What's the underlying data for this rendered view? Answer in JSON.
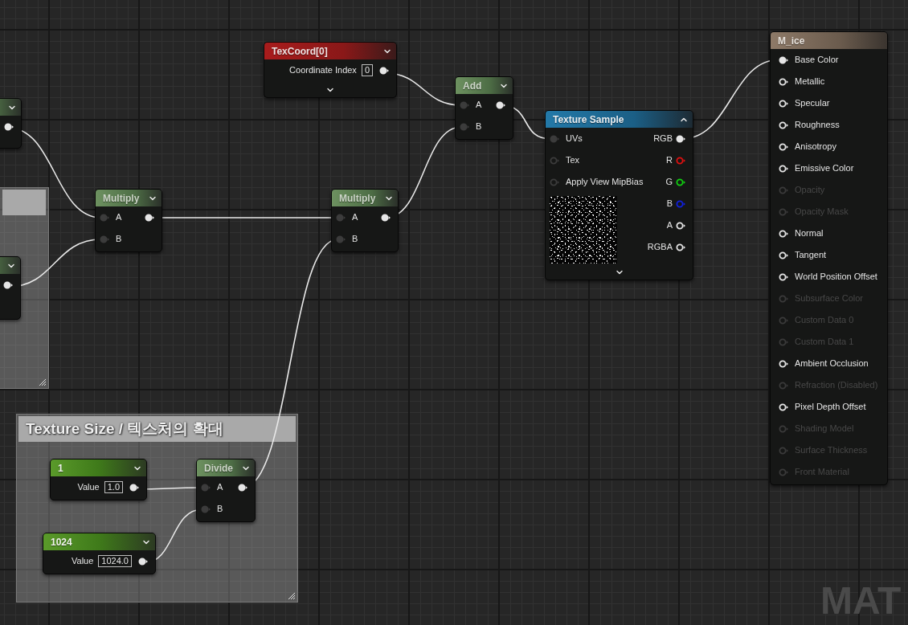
{
  "graph_label": "MAT",
  "comments": [
    {
      "kind": "comment"
    },
    {
      "kind": "comment",
      "title": "Texture Size / 텍스처의 확대"
    }
  ],
  "nodes": [
    {
      "kind": "math",
      "outputs": [
        {
          "connected": true
        }
      ]
    },
    {
      "kind": "texcoord",
      "title": "TexCoord[0]",
      "property": {
        "label": "Coordinate Index",
        "value": "0"
      },
      "outputs": [
        {
          "connected": true
        }
      ]
    },
    {
      "kind": "math",
      "title": "Add",
      "inputs": [
        {
          "label": "A",
          "connected": true
        },
        {
          "label": "B",
          "connected": true
        }
      ],
      "outputs": [
        {
          "connected": true
        }
      ]
    },
    {
      "kind": "texture",
      "title": "Texture Sample",
      "inputs": [
        {
          "label": "UVs",
          "connected": true
        },
        {
          "label": "Tex",
          "connected": false
        },
        {
          "label": "Apply View MipBias",
          "connected": false
        }
      ],
      "outputs": [
        {
          "label": "RGB",
          "connected": true
        },
        {
          "label": "R",
          "connected": false,
          "color": "#e01010"
        },
        {
          "label": "G",
          "connected": false,
          "color": "#10d010"
        },
        {
          "label": "B",
          "connected": false,
          "color": "#1020e0"
        },
        {
          "label": "A",
          "connected": false
        },
        {
          "label": "RGBA",
          "connected": false
        }
      ]
    },
    {
      "kind": "result",
      "title": "M_ice",
      "inputs": [
        {
          "label": "Base Color",
          "connected": true,
          "disabled": false
        },
        {
          "label": "Metallic",
          "connected": false,
          "disabled": false
        },
        {
          "label": "Specular",
          "connected": false,
          "disabled": false
        },
        {
          "label": "Roughness",
          "connected": false,
          "disabled": false
        },
        {
          "label": "Anisotropy",
          "connected": false,
          "disabled": false
        },
        {
          "label": "Emissive Color",
          "connected": false,
          "disabled": false
        },
        {
          "label": "Opacity",
          "connected": false,
          "disabled": true
        },
        {
          "label": "Opacity Mask",
          "connected": false,
          "disabled": true
        },
        {
          "label": "Normal",
          "connected": false,
          "disabled": false
        },
        {
          "label": "Tangent",
          "connected": false,
          "disabled": false
        },
        {
          "label": "World Position Offset",
          "connected": false,
          "disabled": false
        },
        {
          "label": "Subsurface Color",
          "connected": false,
          "disabled": true
        },
        {
          "label": "Custom Data 0",
          "connected": false,
          "disabled": true
        },
        {
          "label": "Custom Data 1",
          "connected": false,
          "disabled": true
        },
        {
          "label": "Ambient Occlusion",
          "connected": false,
          "disabled": false
        },
        {
          "label": "Refraction (Disabled)",
          "connected": false,
          "disabled": true
        },
        {
          "label": "Pixel Depth Offset",
          "connected": false,
          "disabled": false
        },
        {
          "label": "Shading Model",
          "connected": false,
          "disabled": true
        },
        {
          "label": "Surface Thickness",
          "connected": false,
          "disabled": true
        },
        {
          "label": "Front Material",
          "connected": false,
          "disabled": true
        }
      ]
    },
    {
      "kind": "math",
      "title": "Multiply",
      "inputs": [
        {
          "label": "A",
          "connected": true
        },
        {
          "label": "B",
          "connected": true
        }
      ],
      "outputs": [
        {
          "connected": true
        }
      ]
    },
    {
      "kind": "math",
      "title": "Multiply",
      "inputs": [
        {
          "label": "A",
          "connected": true
        },
        {
          "label": "B",
          "connected": true
        }
      ],
      "outputs": [
        {
          "connected": true
        }
      ]
    },
    {
      "kind": "math",
      "outputs": [
        {
          "connected": true
        }
      ]
    },
    {
      "kind": "constant",
      "title": "1",
      "property": {
        "label": "Value",
        "value": "1.0"
      },
      "outputs": [
        {
          "connected": true
        }
      ]
    },
    {
      "kind": "math",
      "title": "Divide",
      "inputs": [
        {
          "label": "A",
          "connected": true
        },
        {
          "label": "B",
          "connected": true
        }
      ],
      "outputs": [
        {
          "connected": true
        }
      ]
    },
    {
      "kind": "constant",
      "title": "1024",
      "property": {
        "label": "Value",
        "value": "1024.0"
      },
      "outputs": [
        {
          "connected": true
        }
      ]
    }
  ]
}
